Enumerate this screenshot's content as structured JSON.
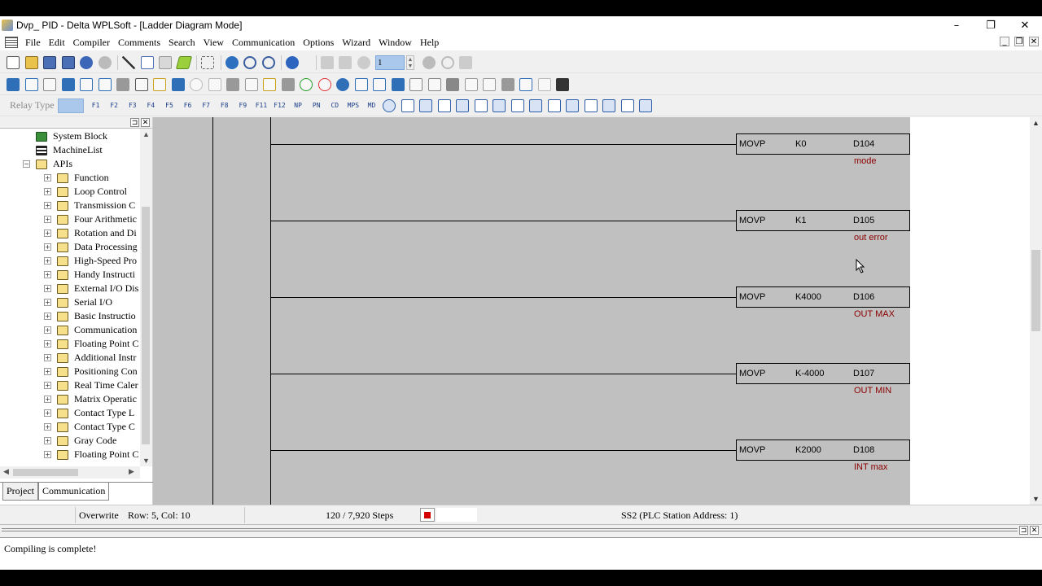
{
  "window": {
    "title": "Dvp_ PID - Delta WPLSoft - [Ladder Diagram Mode]"
  },
  "menu": [
    "File",
    "Edit",
    "Compiler",
    "Comments",
    "Search",
    "View",
    "Communication",
    "Options",
    "Wizard",
    "Window",
    "Help"
  ],
  "toolbar": {
    "step_value": "1",
    "relay_type_label": "Relay Type",
    "fkeys": [
      "F1",
      "F2",
      "F3",
      "F4",
      "F5",
      "F6",
      "F7",
      "F8",
      "F9",
      "F11",
      "F12",
      "NP",
      "PN",
      "CD",
      "MPS",
      "MD"
    ]
  },
  "tree": [
    {
      "label": "System Block",
      "level": 0,
      "icon": "system-block-icon",
      "expander": ""
    },
    {
      "label": "MachineList",
      "level": 0,
      "icon": "machine-list-icon",
      "expander": ""
    },
    {
      "label": "APIs",
      "level": 0,
      "icon": "folder-icon",
      "expander": "−"
    },
    {
      "label": "Function",
      "level": 1,
      "icon": "folder-icon",
      "expander": "+"
    },
    {
      "label": "Loop Control",
      "level": 1,
      "icon": "folder-icon",
      "expander": "+"
    },
    {
      "label": "Transmission C",
      "level": 1,
      "icon": "folder-icon",
      "expander": "+"
    },
    {
      "label": "Four Arithmetic",
      "level": 1,
      "icon": "folder-icon",
      "expander": "+"
    },
    {
      "label": "Rotation and Di",
      "level": 1,
      "icon": "folder-icon",
      "expander": "+"
    },
    {
      "label": "Data Processing",
      "level": 1,
      "icon": "folder-icon",
      "expander": "+"
    },
    {
      "label": "High-Speed Pro",
      "level": 1,
      "icon": "folder-icon",
      "expander": "+"
    },
    {
      "label": "Handy Instructi",
      "level": 1,
      "icon": "folder-icon",
      "expander": "+"
    },
    {
      "label": "External I/O Dis",
      "level": 1,
      "icon": "folder-icon",
      "expander": "+"
    },
    {
      "label": "Serial I/O",
      "level": 1,
      "icon": "folder-icon",
      "expander": "+"
    },
    {
      "label": "Basic Instructio",
      "level": 1,
      "icon": "folder-icon",
      "expander": "+"
    },
    {
      "label": "Communication",
      "level": 1,
      "icon": "folder-icon",
      "expander": "+"
    },
    {
      "label": "Floating Point C",
      "level": 1,
      "icon": "folder-icon",
      "expander": "+"
    },
    {
      "label": "Additional Instr",
      "level": 1,
      "icon": "folder-icon",
      "expander": "+"
    },
    {
      "label": "Positioning Con",
      "level": 1,
      "icon": "folder-icon",
      "expander": "+"
    },
    {
      "label": "Real Time Caler",
      "level": 1,
      "icon": "folder-icon",
      "expander": "+"
    },
    {
      "label": "Matrix Operatic",
      "level": 1,
      "icon": "folder-icon",
      "expander": "+"
    },
    {
      "label": "Contact Type L",
      "level": 1,
      "icon": "folder-icon",
      "expander": "+"
    },
    {
      "label": "Contact Type C",
      "level": 1,
      "icon": "folder-icon",
      "expander": "+"
    },
    {
      "label": "Gray Code",
      "level": 1,
      "icon": "folder-icon",
      "expander": "+"
    },
    {
      "label": "Floating Point C",
      "level": 1,
      "icon": "folder-icon",
      "expander": "+"
    }
  ],
  "tabs": [
    "Project",
    "Communication"
  ],
  "rungs": [
    {
      "op": "MOVP",
      "src": "K0",
      "dst": "D104",
      "comment": "mode"
    },
    {
      "op": "MOVP",
      "src": "K1",
      "dst": "D105",
      "comment": "out error"
    },
    {
      "op": "MOVP",
      "src": "K4000",
      "dst": "D106",
      "comment": "OUT MAX"
    },
    {
      "op": "MOVP",
      "src": "K-4000",
      "dst": "D107",
      "comment": "OUT MIN"
    },
    {
      "op": "MOVP",
      "src": "K2000",
      "dst": "D108",
      "comment": "INT max"
    }
  ],
  "status": {
    "mode": "Overwrite",
    "position": "Row: 5, Col: 10",
    "steps": "120 / 7,920 Steps",
    "station": "SS2 (PLC Station Address: 1)"
  },
  "output": {
    "message": "Compiling is complete!"
  },
  "colors": {
    "ladder_bg": "#c0c0c0",
    "comment": "#8b0000",
    "accent": "#a9c8ec"
  }
}
